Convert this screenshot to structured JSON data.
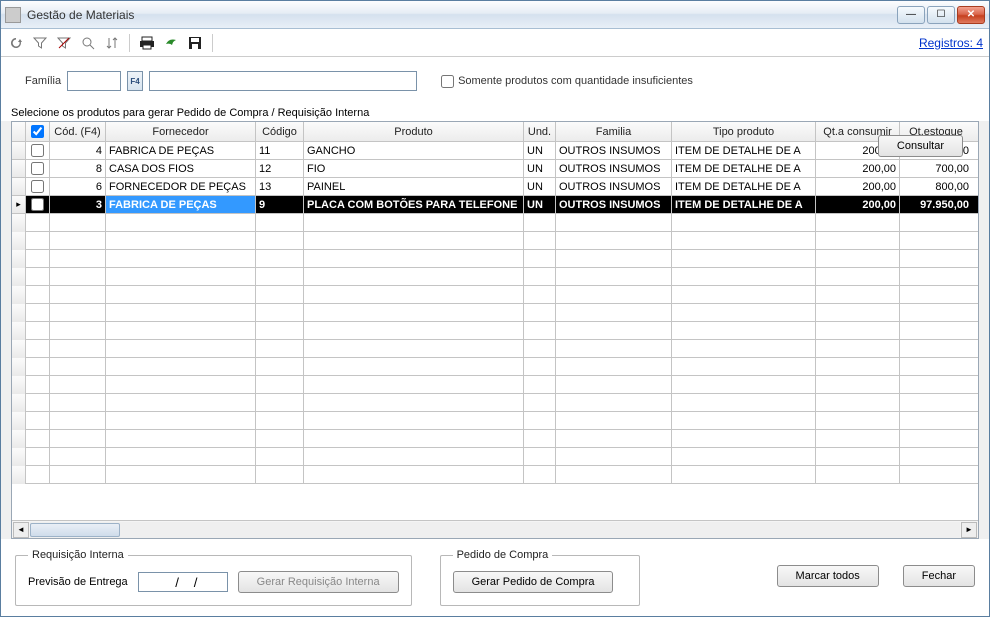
{
  "window": {
    "title": "Gestão de Materiais"
  },
  "toolbar": {
    "registros": "Registros: 4"
  },
  "filter": {
    "familia_label": "Família",
    "somente_label": "Somente produtos com quantidade insuficientes",
    "consultar": "Consultar"
  },
  "instruction": "Selecione os produtos para gerar Pedido de Compra / Requisição Interna",
  "grid": {
    "headers": {
      "chk": "☑",
      "cod": "Cód. (F4)",
      "fornecedor": "Fornecedor",
      "codigo": "Código",
      "produto": "Produto",
      "und": "Und.",
      "familia": "Familia",
      "tipo": "Tipo produto",
      "qtcons": "Qt.a consumir",
      "qtest": "Qt.estoque"
    },
    "rows": [
      {
        "marker": "",
        "cod": "4",
        "fornecedor": "FABRICA DE PEÇAS",
        "codigo": "11",
        "produto": "GANCHO",
        "und": "UN",
        "familia": "OUTROS INSUMOS",
        "tipo": "ITEM DE DETALHE DE A",
        "qtcons": "200,00",
        "qtest": "790,00",
        "selected": false
      },
      {
        "marker": "",
        "cod": "8",
        "fornecedor": "CASA DOS FIOS",
        "codigo": "12",
        "produto": "FIO",
        "und": "UN",
        "familia": "OUTROS INSUMOS",
        "tipo": "ITEM DE DETALHE DE A",
        "qtcons": "200,00",
        "qtest": "700,00",
        "selected": false
      },
      {
        "marker": "",
        "cod": "6",
        "fornecedor": "FORNECEDOR DE PEÇAS",
        "codigo": "13",
        "produto": "PAINEL",
        "und": "UN",
        "familia": "OUTROS INSUMOS",
        "tipo": "ITEM DE DETALHE DE A",
        "qtcons": "200,00",
        "qtest": "800,00",
        "selected": false
      },
      {
        "marker": "▸",
        "cod": "3",
        "fornecedor": "FABRICA DE PEÇAS",
        "codigo": "9",
        "produto": "PLACA COM BOTÕES PARA TELEFONE",
        "und": "UN",
        "familia": "OUTROS INSUMOS",
        "tipo": "ITEM DE DETALHE DE A",
        "qtcons": "200,00",
        "qtest": "97.950,00",
        "selected": true
      }
    ]
  },
  "bottom": {
    "req_legend": "Requisição Interna",
    "prev_entrega": "Previsão de Entrega",
    "date_value": "  /    /",
    "gerar_req": "Gerar Requisição Interna",
    "ped_legend": "Pedido de Compra",
    "gerar_ped": "Gerar Pedido de Compra",
    "marcar_todos": "Marcar todos",
    "fechar": "Fechar"
  }
}
